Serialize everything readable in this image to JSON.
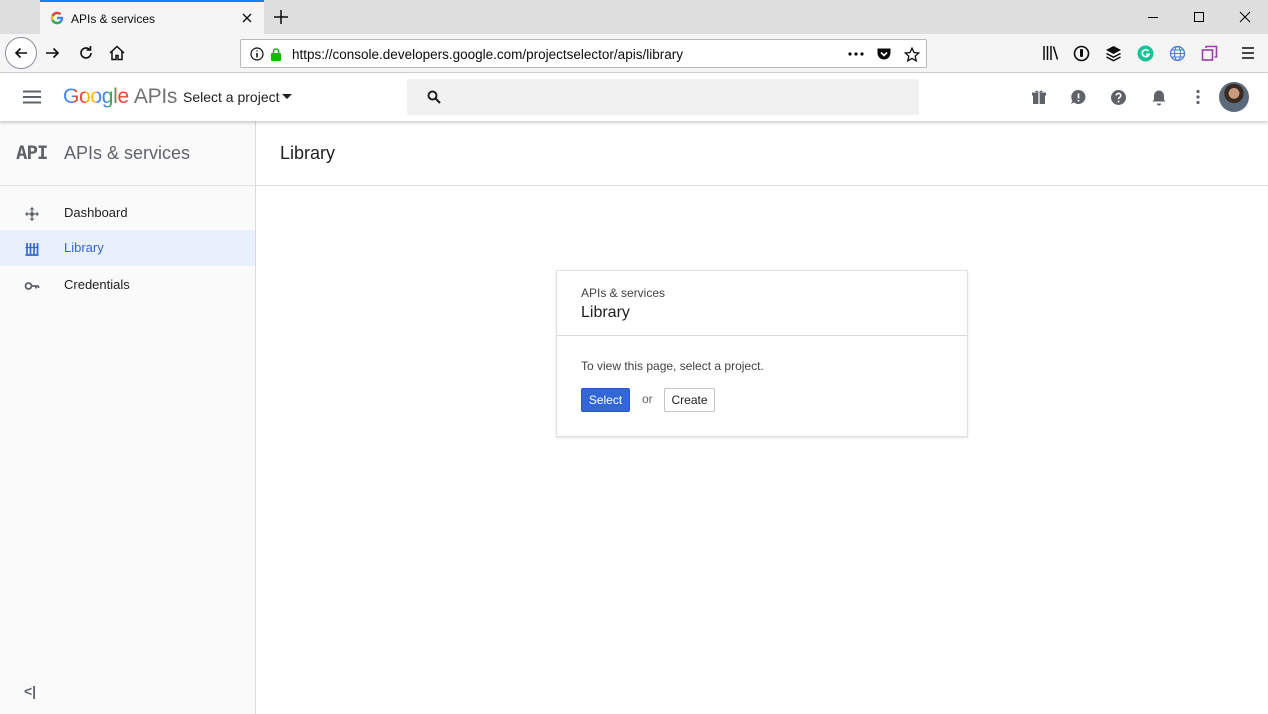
{
  "browser": {
    "tab_title": "APIs & services",
    "url": "https://console.developers.google.com/projectselector/apis/library",
    "icons": [
      "google-favicon",
      "close-icon",
      "plus-icon",
      "minimize-icon",
      "maximize-icon",
      "close-window-icon",
      "back-icon",
      "forward-icon",
      "reload-icon",
      "home-icon",
      "info-icon",
      "lock-icon",
      "more-icon",
      "pocket-icon",
      "star-icon",
      "library-icon",
      "password-icon",
      "layers-icon",
      "grammarly-icon",
      "globe-icon",
      "tab-icon",
      "menu-icon"
    ]
  },
  "header": {
    "logo_google": "Google",
    "logo_apis": "APIs",
    "project_selector": "Select a project",
    "search_placeholder": "",
    "icons": [
      "hamburger-icon",
      "search-icon",
      "gift-icon",
      "feedback-icon",
      "help-icon",
      "notifications-icon",
      "more-vert-icon",
      "avatar"
    ]
  },
  "sidebar": {
    "logo": "API",
    "title": "APIs & services",
    "items": [
      {
        "label": "Dashboard",
        "icon": "dashboard-icon",
        "active": false
      },
      {
        "label": "Library",
        "icon": "library-icon",
        "active": true
      },
      {
        "label": "Credentials",
        "icon": "key-icon",
        "active": false
      }
    ],
    "collapse": "<|"
  },
  "main": {
    "title": "Library",
    "card": {
      "subtitle": "APIs & services",
      "title": "Library",
      "message": "To view this page, select a project.",
      "select_label": "Select",
      "or_label": "or",
      "create_label": "Create"
    }
  },
  "colors": {
    "accent": "#3367d6",
    "active_bg": "#e8f0fe",
    "browser_accent": "#0a84ff"
  }
}
